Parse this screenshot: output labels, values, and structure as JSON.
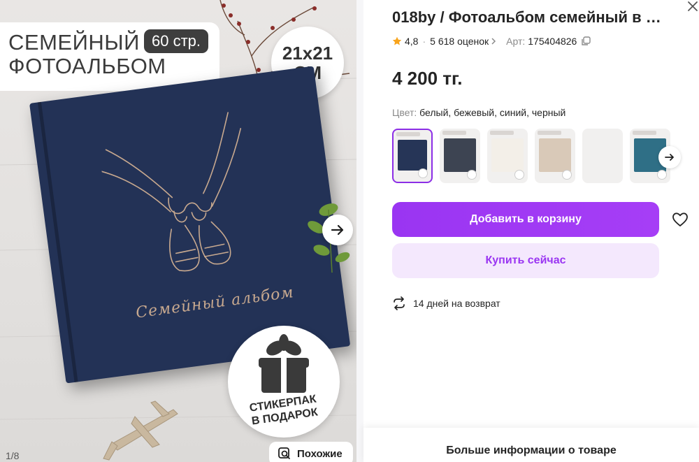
{
  "gallery": {
    "promo_title": "СЕМЕЙНЫЙ\nФОТОАЛЬБОМ",
    "pages_badge": "60 стр.",
    "size_number": "21х21",
    "size_unit": "СМ",
    "album_cover_text": "Семейный альбом",
    "gift_stamp_text": "СТИКЕРПАК\nВ ПОДАРОК",
    "counter": "1/8",
    "similar_label": "Похожие",
    "next_icon": "arrow-right-icon"
  },
  "product": {
    "title": "018by / Фотоальбом семейный в …",
    "rating": "4,8",
    "reviews": "5 618 оценок",
    "article_label": "Арт:",
    "article_value": "175404826",
    "price": "4 200 тг.",
    "color_label": "Цвет:",
    "color_values": "белый, бежевый, синий, черный",
    "swatches": [
      {
        "name": "dark-blue",
        "cover": "#263557",
        "selected": true
      },
      {
        "name": "dark-grey",
        "cover": "#3d4452",
        "selected": false
      },
      {
        "name": "white",
        "cover": "#f3efe8",
        "selected": false
      },
      {
        "name": "beige",
        "cover": "#d9c9b8",
        "selected": false
      },
      {
        "name": "empty",
        "cover": "#f5f5f5",
        "selected": false
      },
      {
        "name": "teal-pattern",
        "cover": "#2f6f86",
        "selected": false
      }
    ],
    "add_to_cart": "Добавить в корзину",
    "buy_now": "Купить сейчас",
    "returns": "14 дней на возврат",
    "more_info": "Больше информации о товаре"
  },
  "colors": {
    "accent": "#a13df4",
    "accent_soft": "#f4e8fd",
    "star": "#f8a41c",
    "album_navy": "#233256"
  }
}
